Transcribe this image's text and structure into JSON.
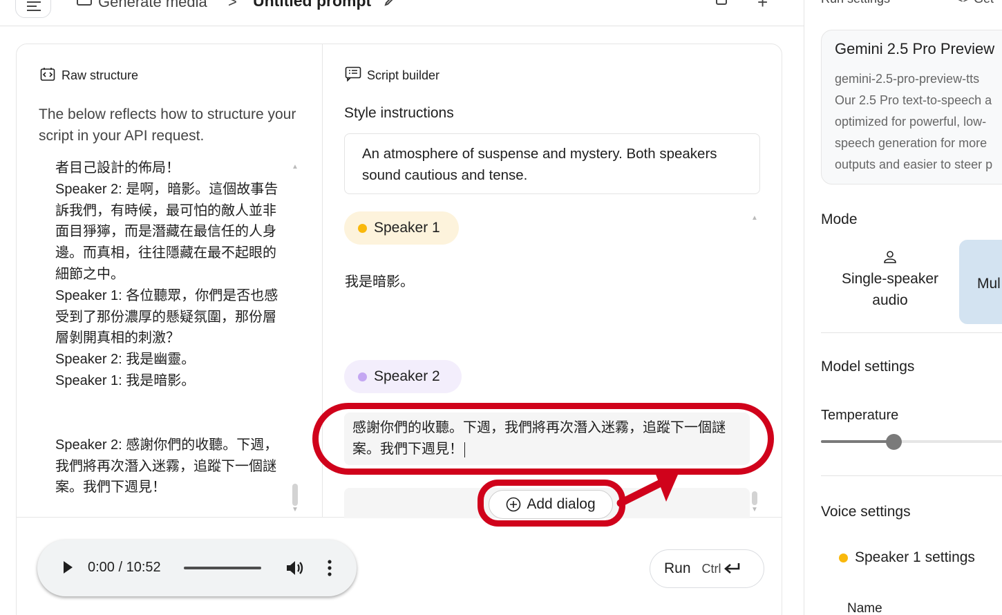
{
  "header": {
    "breadcrumb_parent": "Generate media",
    "breadcrumb_separator": ">",
    "breadcrumb_title": "Untitled prompt",
    "plus_label": "+"
  },
  "raw_structure": {
    "title": "Raw structure",
    "description": "The below reflects how to structure your script in your API request.",
    "lines": [
      "者目己設計的佈局！",
      "Speaker 2: 是啊，暗影。這個故事告訴我們，有時候，最可怕的敵人並非面目猙獰，而是潛藏在最信任的人身邊。而真相，往往隱藏在最不起眼的細節之中。",
      "Speaker 1: 各位聽眾，你們是否也感受到了那份濃厚的懸疑氛圍，那份層層剝開真相的刺激？",
      "Speaker 2: 我是幽靈。",
      "Speaker 1: 我是暗影。",
      "Speaker 2: 感謝你們的收聽。下週，我們將再次潛入迷霧，追蹤下一個謎案。我們下週見！"
    ]
  },
  "script_builder": {
    "title": "Script builder",
    "style_label": "Style instructions",
    "style_text": "An atmosphere of suspense and mystery. Both speakers sound cautious and tense.",
    "speaker1": {
      "label": "Speaker 1",
      "color": "#f9b80c",
      "dialog": "我是暗影。"
    },
    "speaker2": {
      "label": "Speaker 2",
      "color": "#c4a7f2",
      "dialog": "感謝你們的收聽。下週，我們將再次潛入迷霧，追蹤下一個謎案。我們下週見！"
    },
    "add_dialog_label": "Add dialog"
  },
  "audio": {
    "time": "0:00 / 10:52",
    "progress": 0.0
  },
  "run": {
    "label": "Run",
    "shortcut": "Ctrl"
  },
  "settings": {
    "header": "Run settings",
    "header_right": "<> Get",
    "model_name": "Gemini 2.5 Pro Preview",
    "model_id": "gemini-2.5-pro-preview-tts",
    "model_desc_lines": [
      "Our 2.5 Pro text-to-speech a",
      "optimized for powerful, low-",
      "speech generation for more",
      "outputs and easier to steer p"
    ],
    "mode_label": "Mode",
    "mode_single": "Single-speaker audio",
    "mode_multi": "Mul",
    "model_settings_label": "Model settings",
    "temperature_label": "Temperature",
    "temperature_fraction": 0.4,
    "voice_settings_label": "Voice settings",
    "speaker1_settings_label": "Speaker 1 settings",
    "name_label": "Name"
  },
  "annotation_color": "#d0021b"
}
